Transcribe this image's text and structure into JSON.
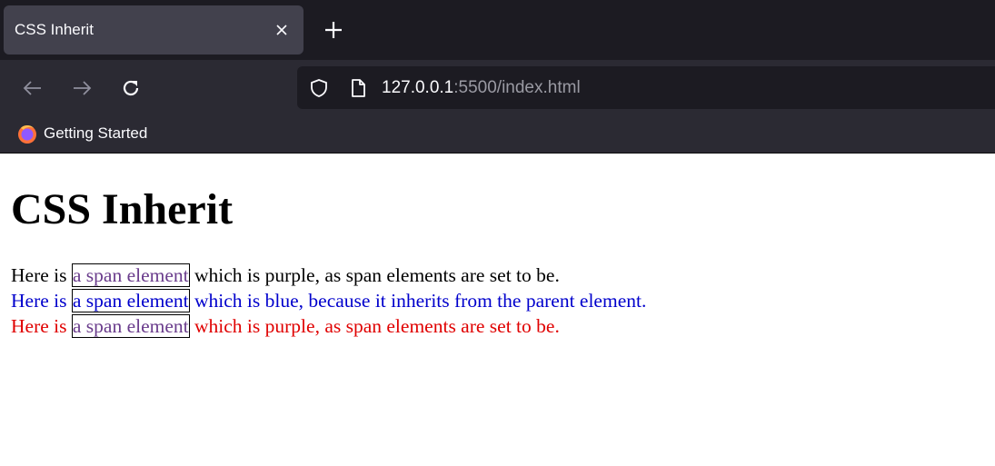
{
  "browser": {
    "tab_title": "CSS Inherit",
    "url_host": "127.0.0.1",
    "url_rest": ":5500/index.html",
    "bookmark_label": "Getting Started"
  },
  "page": {
    "heading": "CSS Inherit",
    "lines": [
      {
        "before": "Here is ",
        "span": "a span element",
        "after": " which is purple, as span elements are set to be.",
        "color": "#000000"
      },
      {
        "before": "Here is ",
        "span": "a span element",
        "after": " which is blue, because it inherits from the parent element.",
        "color": "#0000cc"
      },
      {
        "before": "Here is ",
        "span": "a span element",
        "after": " which is purple, as span elements are set to be.",
        "color": "#e00000"
      }
    ],
    "span_color": "#6a3c8c"
  }
}
